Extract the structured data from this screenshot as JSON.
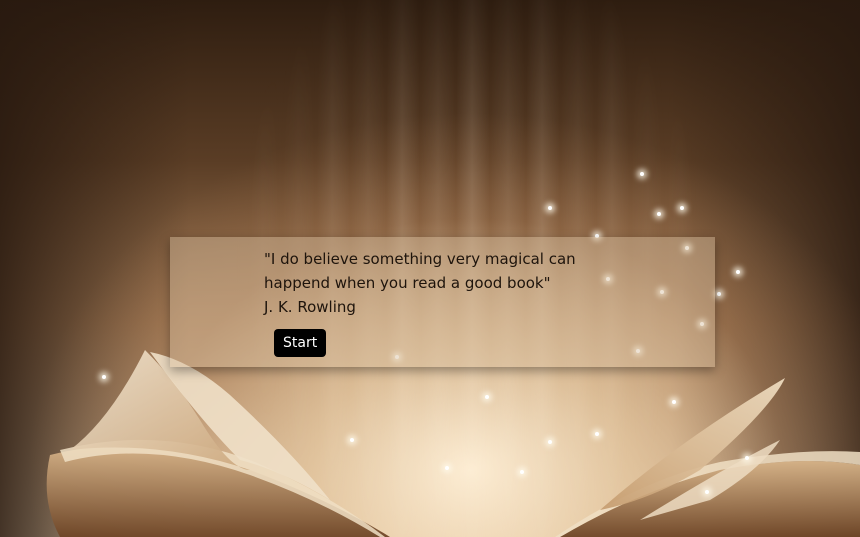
{
  "quote": {
    "text": "\"I do believe something very magical can happend when you read a good book\"",
    "author": "J. K. Rowling"
  },
  "start_button": {
    "label": "Start"
  },
  "background": {
    "image": "magical-open-book",
    "colors": {
      "dark": "#2e1d10",
      "mid": "#a57d58",
      "light": "#f3e4cc"
    }
  }
}
